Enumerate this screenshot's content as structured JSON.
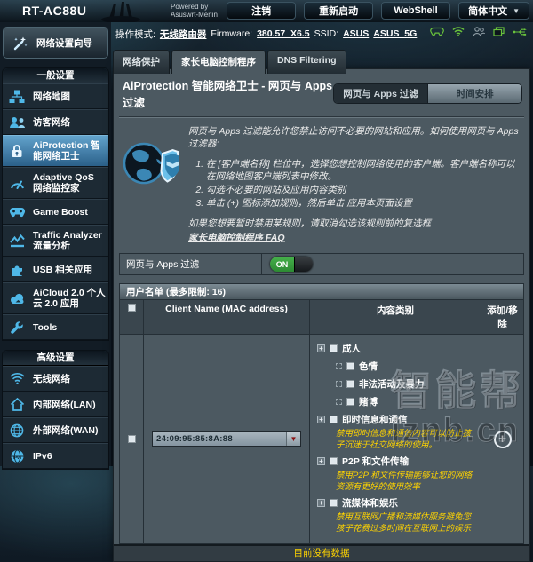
{
  "header": {
    "logo": "RT-AC88U",
    "powered_by_line1": "Powered by",
    "powered_by_line2": "Asuswrt-Merlin",
    "logout": "注销",
    "reboot": "重新启动",
    "webshell": "WebShell",
    "language": "简体中文"
  },
  "statusbar": {
    "op_mode_label": "操作模式:",
    "op_mode_value": "无线路由器",
    "firmware_label": "Firmware:",
    "firmware_value": "380.57_X6.5",
    "ssid_label": "SSID:",
    "ssid_1": "ASUS",
    "ssid_2": "ASUS_5G"
  },
  "sidebar": {
    "qis": "网络设置向导",
    "sections": [
      {
        "header": "一般设置",
        "items": [
          {
            "label": "网络地图"
          },
          {
            "label": "访客网络"
          },
          {
            "label": "AiProtection 智能网络卫士"
          },
          {
            "label": "Adaptive QoS 网络监控家"
          },
          {
            "label": "Game Boost"
          },
          {
            "label": "Traffic Analyzer 流量分析"
          },
          {
            "label": "USB 相关应用"
          },
          {
            "label": "AiCloud 2.0 个人云 2.0 应用"
          },
          {
            "label": "Tools"
          }
        ]
      },
      {
        "header": "高级设置",
        "items": [
          {
            "label": "无线网络"
          },
          {
            "label": "内部网络(LAN)"
          },
          {
            "label": "外部网络(WAN)"
          },
          {
            "label": "IPv6"
          }
        ]
      }
    ]
  },
  "tabs": {
    "tab1": "网络保护",
    "tab2": "家长电脑控制程序",
    "tab3": "DNS Filtering"
  },
  "main": {
    "title": "AiProtection 智能网络卫士 - 网页与 Apps 过滤",
    "btn_webapps": "网页与 Apps 过滤",
    "btn_schedule": "时间安排",
    "desc_intro": "网页与 Apps 过滤能允许您禁止访问不必要的网站和应用。如何使用网页与 Apps 过滤器:",
    "step1": "在 [客户端名称] 栏位中，选择您想控制网络使用的客户端。客户端名称可以在网络地图客户端列表中修改。",
    "step2": "勾选不必要的网站及应用内容类别",
    "step3": "单击 (+) 图标添加规则，然后单击 应用本页面设置",
    "note": "如果您想要暂时禁用某规则，请取消勾选该规则前的复选框",
    "faq": "家长电脑控制程序 FAQ",
    "toggle_label": "网页与 Apps 过滤",
    "toggle_state": "ON"
  },
  "table": {
    "title": "用户名单 (最多限制:  16)",
    "col_name": "Client Name (MAC address)",
    "col_category": "内容类别",
    "col_add": "添加/移除",
    "mac": "24:09:95:85:8A:88",
    "cat1": "成人",
    "cat1_child1": "色情",
    "cat1_child2": "非法活动及暴力",
    "cat1_child3": "赌博",
    "cat2": "即时信息和通信",
    "cat2_desc": "禁用即时信息和通信内容可以防止孩子沉迷于社交网络的使用。",
    "cat3": "P2P 和文件传输",
    "cat3_desc": "禁用P2P 和文件传输能够让您的网络资源有更好的使用效率",
    "cat4": "流媒体和娱乐",
    "cat4_desc": "禁用互联网广播和流媒体服务避免您孩子花费过多时间在互联网上的娱乐",
    "empty": "目前没有数据",
    "plus": "+"
  },
  "watermark": {
    "line1": "智能帮",
    "line2": "iznb.cn"
  }
}
